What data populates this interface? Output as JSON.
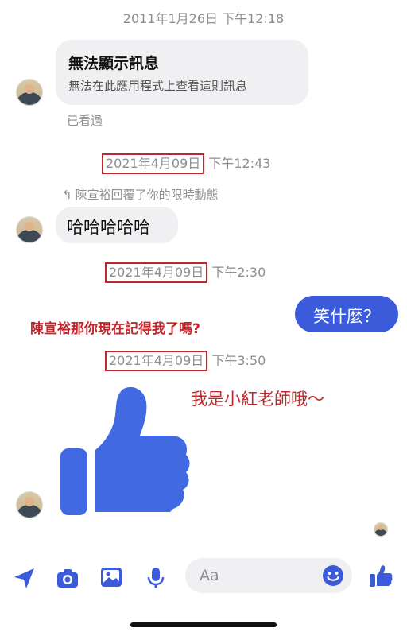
{
  "messages": {
    "ts1": "2011年1月26日 下午12:18",
    "unavailable_title": "無法顯示訊息",
    "unavailable_sub": "無法在此應用程式上查看這則訊息",
    "seen": "已看過",
    "ts2_date": "2021年4月09日",
    "ts2_time": "下午12:43",
    "reply_note": "陳宣裕回覆了你的限時動態",
    "haha": "哈哈哈哈哈",
    "ts3_date": "2021年4月09日",
    "ts3_time": "下午2:30",
    "laugh_question": "笑什麼？",
    "annotation1": "陳宣裕那你現在記得我了嗎?",
    "ts4_date": "2021年4月09日",
    "ts4_time": "下午3:50",
    "annotation2": "我是小紅老師哦～"
  },
  "composer": {
    "placeholder": "Aa"
  },
  "colors": {
    "messenger_blue": "#3b5bdb",
    "like_blue": "#4169e1",
    "annotation_red": "#c0272d"
  },
  "icons": [
    "send-location-icon",
    "camera-icon",
    "image-icon",
    "microphone-icon",
    "emoji-icon",
    "like-icon"
  ]
}
